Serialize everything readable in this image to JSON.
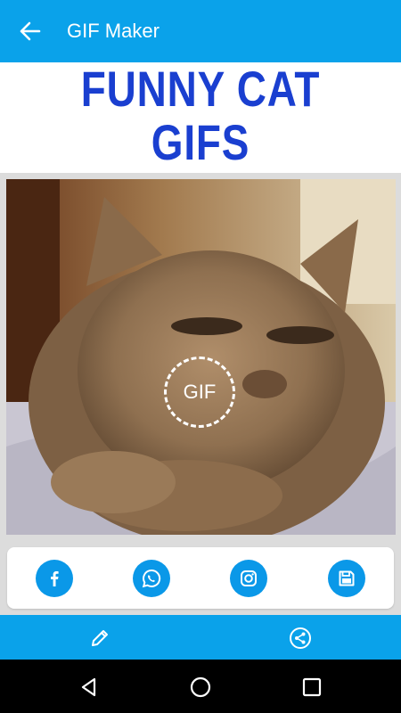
{
  "app_bar": {
    "title": "GIF Maker",
    "back_icon": "arrow-left-icon"
  },
  "header": {
    "line1": "FUNNY CAT",
    "line2": "GIFS",
    "color": "#1a3fd0"
  },
  "preview": {
    "badge_label": "GIF",
    "image": "kitten-photo"
  },
  "share": {
    "buttons": [
      {
        "icon": "facebook-icon"
      },
      {
        "icon": "whatsapp-icon"
      },
      {
        "icon": "instagram-icon"
      },
      {
        "icon": "save-icon"
      }
    ],
    "accent": "#0a98e8"
  },
  "bottom_bar": {
    "left_icon": "pencil-icon",
    "right_icon": "share-icon",
    "color": "#0aa2ea"
  },
  "nav_bar": {
    "icons": [
      "back-triangle-icon",
      "home-circle-icon",
      "recents-square-icon"
    ]
  }
}
